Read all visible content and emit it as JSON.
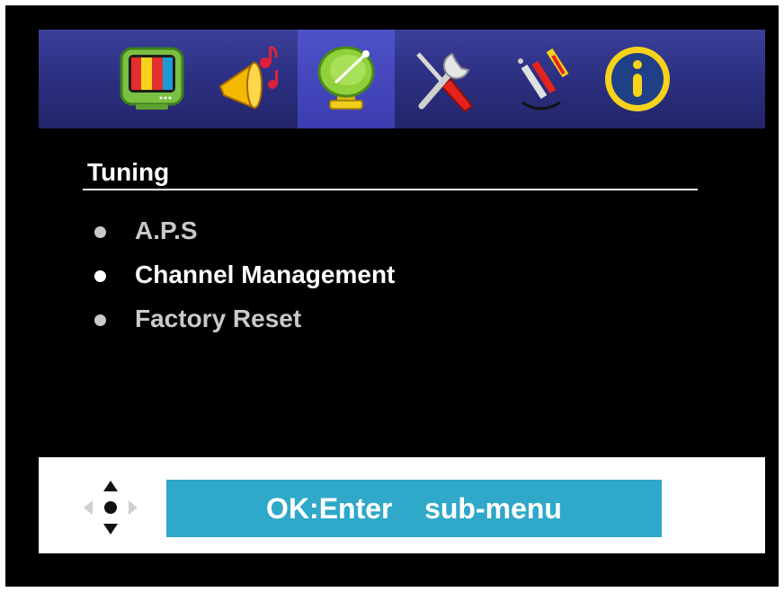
{
  "icon_bar": {
    "tabs": [
      {
        "id": "picture",
        "icon": "tv-icon",
        "active": false
      },
      {
        "id": "sound",
        "icon": "speaker-icon",
        "active": false
      },
      {
        "id": "tuning",
        "icon": "satellite-dish-icon",
        "active": true
      },
      {
        "id": "setup",
        "icon": "tools-icon",
        "active": false
      },
      {
        "id": "input",
        "icon": "av-cable-icon",
        "active": false
      },
      {
        "id": "info",
        "icon": "info-icon",
        "active": false
      }
    ]
  },
  "menu": {
    "title": "Tuning",
    "items": [
      {
        "label": "A.P.S",
        "selected": false
      },
      {
        "label": "Channel Management",
        "selected": true
      },
      {
        "label": "Factory Reset",
        "selected": false
      }
    ]
  },
  "footer": {
    "hint": "OK:Enter    sub-menu",
    "nav_icon": "dpad-icon"
  },
  "colors": {
    "icon_bar": "#2b2e7e",
    "active_tab": "#3b3db0",
    "hint_bg": "#2fa8c9",
    "text": "#ffffff",
    "dim_text": "#c9c9c9"
  }
}
